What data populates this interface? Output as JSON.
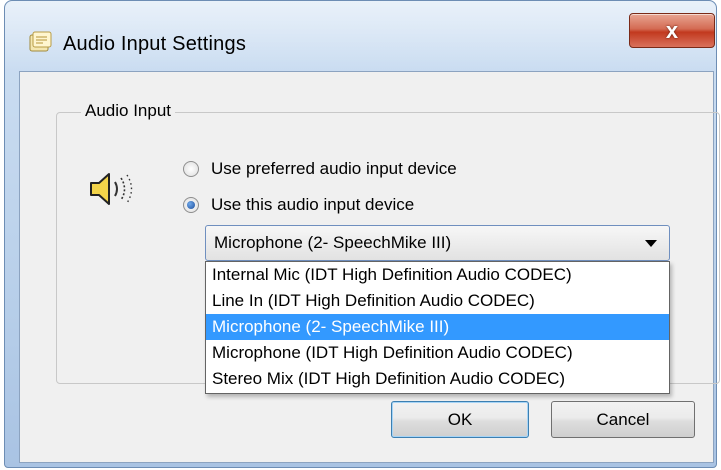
{
  "window": {
    "title": "Audio Input Settings",
    "close_label": "x"
  },
  "group": {
    "label": "Audio Input"
  },
  "radios": [
    {
      "label": "Use preferred audio input device",
      "checked": false
    },
    {
      "label": "Use this audio input device",
      "checked": true
    }
  ],
  "combo": {
    "selected": "Microphone (2- SpeechMike III)"
  },
  "dropdown": {
    "items": [
      "Internal Mic (IDT High Definition Audio CODEC)",
      "Line In (IDT High Definition Audio CODEC)",
      "Microphone (2- SpeechMike III)",
      "Microphone (IDT High Definition Audio CODEC)",
      "Stereo Mix (IDT High Definition Audio CODEC)"
    ],
    "highlighted_index": 2
  },
  "buttons": {
    "ok": "OK",
    "cancel": "Cancel"
  },
  "icons": {
    "app": "settings-note-icon",
    "speaker": "speaker-icon"
  }
}
